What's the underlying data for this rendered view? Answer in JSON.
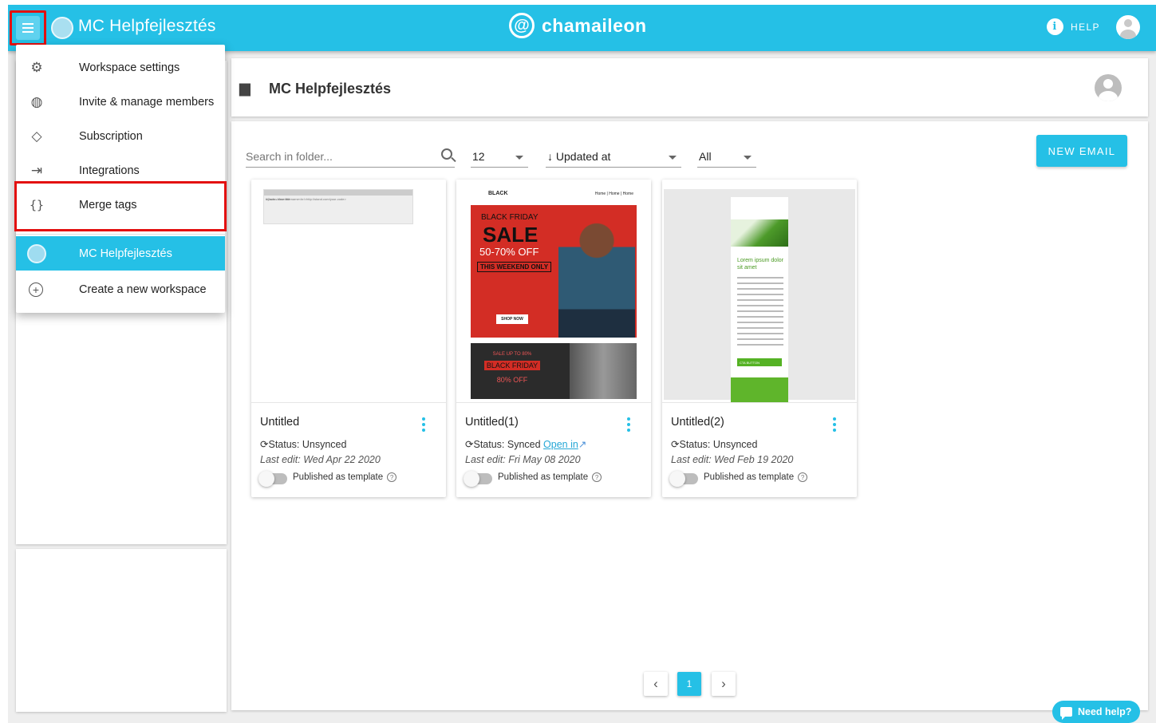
{
  "topbar": {
    "workspace_title": "MC Helpfejlesztés",
    "brand_symbol": "@",
    "brand": "chamaileon",
    "help_label": "HELP",
    "accent_color": "#25c0e6"
  },
  "menu": {
    "items": [
      {
        "label": "Workspace settings",
        "icon": "gear-icon"
      },
      {
        "label": "Invite & manage members",
        "icon": "members-icon"
      },
      {
        "label": "Subscription",
        "icon": "diamond-icon"
      },
      {
        "label": "Integrations",
        "icon": "integrations-icon"
      },
      {
        "label": "Merge tags",
        "icon": "braces-icon"
      }
    ],
    "workspaces": [
      {
        "label": "MC Helpfejlesztés",
        "active": true
      }
    ],
    "create_label": "Create a new workspace"
  },
  "header": {
    "title": "MC Helpfejlesztés"
  },
  "toolbar": {
    "search_placeholder": "Search in folder...",
    "page_size": "12",
    "sort": "Updated at",
    "filter": "All",
    "new_email_label": "NEW EMAIL"
  },
  "cards": [
    {
      "title": "Untitled",
      "status": "Status: Unsynced",
      "open_link": "",
      "last_edit": "Last edit: Wed Apr 22 2020",
      "published_label": "Published as template",
      "published": false,
      "thumb": {
        "line1": "#Code - Your title",
        "line2": "<your-code><br/>name<br/>http://stand.com/your-code>"
      }
    },
    {
      "title": "Untitled(1)",
      "status": "Status: Synced",
      "open_link": "Open in",
      "last_edit": "Last edit: Fri May 08 2020",
      "published_label": "Published as template",
      "published": false,
      "thumb": {
        "brand": "BLACK",
        "nav": "Home | Home | Home",
        "t1": "BLACK FRIDAY",
        "t2": "SALE",
        "t3": "50-70% OFF",
        "t4": "THIS WEEKEND ONLY",
        "btn": "SHOP NOW",
        "b1": "SALE UP TO 80%",
        "b2": "BLACK FRIDAY",
        "b3": "80% OFF"
      }
    },
    {
      "title": "Untitled(2)",
      "status": "Status: Unsynced",
      "open_link": "",
      "last_edit": "Last edit: Wed Feb 19 2020",
      "published_label": "Published as template",
      "published": false,
      "thumb": {
        "heading": "Lorem ipsum dolor sit amet",
        "cta": "CTA BUTTON"
      }
    }
  ],
  "pagination": {
    "prev": "‹",
    "current": "1",
    "next": "›"
  },
  "support": {
    "need_help_label": "Need help?"
  }
}
